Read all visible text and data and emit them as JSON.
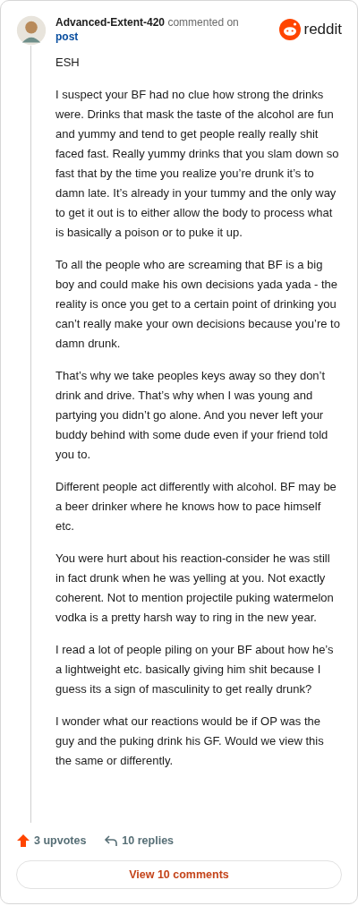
{
  "author": "Advanced-Extent-420",
  "action": "commented on",
  "link": "post",
  "brand": "reddit",
  "paragraphs": [
    "ESH",
    "I suspect your BF had no clue how strong the drinks were. Drinks that mask the taste of the alcohol are fun and yummy and tend to get people really really shit faced fast. Really yummy drinks that you slam down so fast that by the time you realize you’re drunk it’s to damn late. It’s already in your tummy and the only way to get it out is to either allow the body to process what is basically a poison or to puke it up.",
    "To all the people who are screaming that BF is a big boy and could make his own decisions yada yada - the reality is once you get to a certain point of drinking you can’t really make your own decisions because you’re to damn drunk.",
    "That’s why we take peoples keys away so they don’t drink and drive. That’s why when I was young and partying you didn’t go alone. And you never left your buddy behind with some dude even if your friend told you to.",
    "Different people act differently with alcohol. BF may be a beer drinker where he knows how to pace himself etc.",
    "You were hurt about his reaction-consider he was still in fact drunk when he was yelling at you. Not exactly coherent. Not to mention projectile puking watermelon vodka is a pretty harsh way to ring in the new year.",
    "I read a lot of people piling on your BF about how he’s a lightweight etc. basically giving him shit because I guess its a sign of masculinity to get really drunk?",
    "I wonder what our reactions would be if OP was the guy and the puking drink his GF. Would we view this the same or differently."
  ],
  "upvotes": "3 upvotes",
  "replies": "10 replies",
  "view_button": "View 10 comments"
}
